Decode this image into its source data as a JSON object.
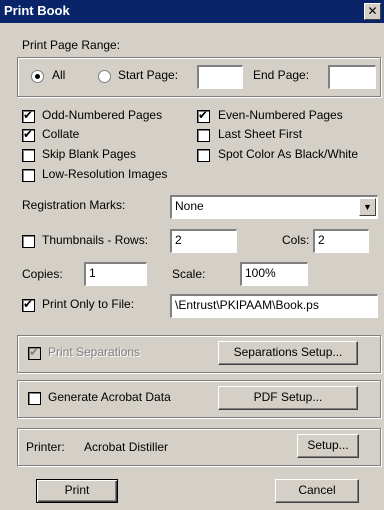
{
  "window": {
    "title": "Print Book",
    "close_glyph": "✕"
  },
  "page_range": {
    "group_label": "Print Page Range:",
    "all_label": "All",
    "all_selected": true,
    "start_label": "Start Page:",
    "start_value": "",
    "end_label": "End Page:",
    "end_value": ""
  },
  "options": {
    "odd_label": "Odd-Numbered Pages",
    "odd_checked": true,
    "even_label": "Even-Numbered Pages",
    "even_checked": true,
    "collate_label": "Collate",
    "collate_checked": true,
    "last_sheet_label": "Last Sheet First",
    "last_sheet_checked": false,
    "skip_blank_label": "Skip Blank Pages",
    "skip_blank_checked": false,
    "spot_color_label": "Spot Color As Black/White",
    "spot_color_checked": false,
    "low_res_label": "Low-Resolution Images",
    "low_res_checked": false
  },
  "registration": {
    "label": "Registration Marks:",
    "value": "None"
  },
  "thumbnails": {
    "label": "Thumbnails - Rows:",
    "checked": false,
    "rows": "2",
    "cols_label": "Cols:",
    "cols": "2"
  },
  "copies": {
    "label": "Copies:",
    "value": "1",
    "scale_label": "Scale:",
    "scale_value": "100%"
  },
  "file": {
    "label": "Print Only to File:",
    "checked": true,
    "path": "\\Entrust\\PKIPAAM\\Book.ps"
  },
  "separations": {
    "label": "Print Separations",
    "checked": true,
    "enabled": false,
    "button_label": "Separations Setup..."
  },
  "acrobat": {
    "label": "Generate Acrobat Data",
    "checked": false,
    "button_label": "PDF Setup..."
  },
  "printer": {
    "label": "Printer:",
    "name": "Acrobat Distiller",
    "button_label": "Setup..."
  },
  "actions": {
    "print_label": "Print",
    "cancel_label": "Cancel"
  }
}
